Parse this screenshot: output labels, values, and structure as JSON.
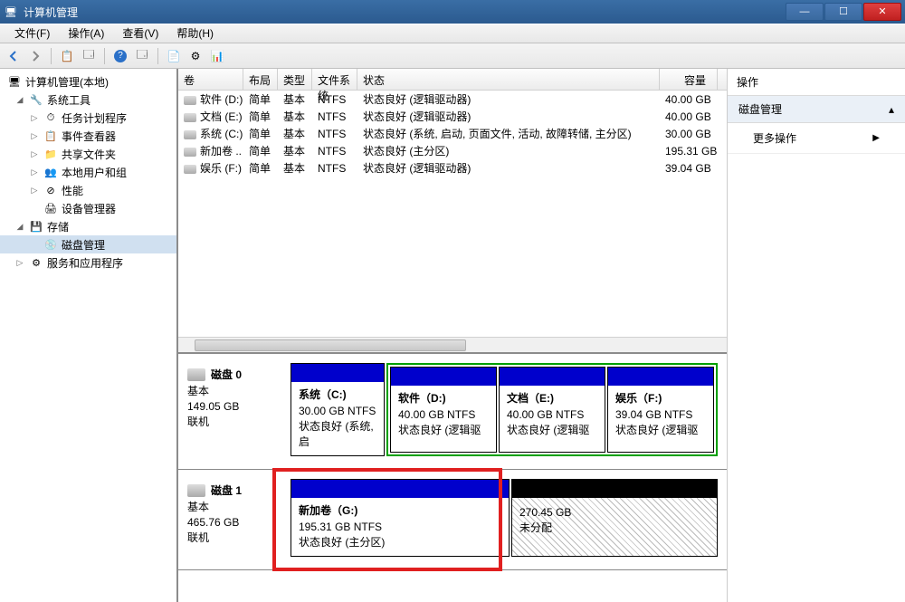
{
  "window": {
    "title": "计算机管理"
  },
  "menu": {
    "file": "文件(F)",
    "action": "操作(A)",
    "view": "查看(V)",
    "help": "帮助(H)"
  },
  "tree": {
    "root": "计算机管理(本地)",
    "sys_tools": "系统工具",
    "task_scheduler": "任务计划程序",
    "event_viewer": "事件查看器",
    "shared_folders": "共享文件夹",
    "local_users": "本地用户和组",
    "performance": "性能",
    "device_mgr": "设备管理器",
    "storage": "存储",
    "disk_mgmt": "磁盘管理",
    "services": "服务和应用程序"
  },
  "grid": {
    "headers": {
      "vol": "卷",
      "layout": "布局",
      "type": "类型",
      "fs": "文件系统",
      "status": "状态",
      "capacity": "容量"
    },
    "rows": [
      {
        "vol": "软件 (D:)",
        "layout": "简单",
        "type": "基本",
        "fs": "NTFS",
        "status": "状态良好 (逻辑驱动器)",
        "capacity": "40.00 GB"
      },
      {
        "vol": "文档 (E:)",
        "layout": "简单",
        "type": "基本",
        "fs": "NTFS",
        "status": "状态良好 (逻辑驱动器)",
        "capacity": "40.00 GB"
      },
      {
        "vol": "系统 (C:)",
        "layout": "简单",
        "type": "基本",
        "fs": "NTFS",
        "status": "状态良好 (系统, 启动, 页面文件, 活动, 故障转储, 主分区)",
        "capacity": "30.00 GB"
      },
      {
        "vol": "新加卷 ..",
        "layout": "简单",
        "type": "基本",
        "fs": "NTFS",
        "status": "状态良好 (主分区)",
        "capacity": "195.31 GB"
      },
      {
        "vol": "娱乐 (F:)",
        "layout": "简单",
        "type": "基本",
        "fs": "NTFS",
        "status": "状态良好 (逻辑驱动器)",
        "capacity": "39.04 GB"
      }
    ]
  },
  "disks": {
    "d0": {
      "name": "磁盘 0",
      "type": "基本",
      "size": "149.05 GB",
      "status": "联机",
      "parts": [
        {
          "label": "系统（C:)",
          "info": "30.00 GB NTFS",
          "state": "状态良好 (系统, 启"
        },
        {
          "label": "软件（D:)",
          "info": "40.00 GB NTFS",
          "state": "状态良好 (逻辑驱"
        },
        {
          "label": "文档（E:)",
          "info": "40.00 GB NTFS",
          "state": "状态良好 (逻辑驱"
        },
        {
          "label": "娱乐（F:)",
          "info": "39.04 GB NTFS",
          "state": "状态良好 (逻辑驱"
        }
      ]
    },
    "d1": {
      "name": "磁盘 1",
      "type": "基本",
      "size": "465.76 GB",
      "status": "联机",
      "parts": [
        {
          "label": "新加卷（G:)",
          "info": "195.31 GB NTFS",
          "state": "状态良好 (主分区)"
        },
        {
          "label": "",
          "info": "270.45 GB",
          "state": "未分配"
        }
      ]
    }
  },
  "actions": {
    "header": "操作",
    "group": "磁盘管理",
    "more": "更多操作"
  }
}
